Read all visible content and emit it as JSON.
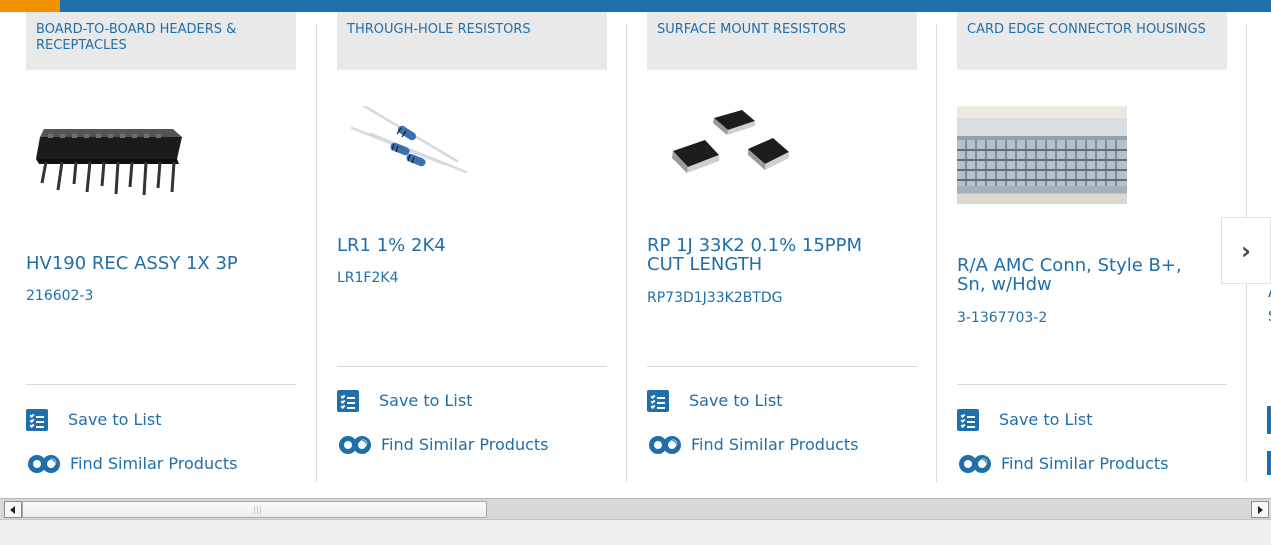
{
  "theme": {
    "brand_blue": "#1f6fab",
    "accent_orange": "#f29100",
    "category_bg": "#e9e9e9",
    "divider": "#d9d9d9"
  },
  "carousel": {
    "next_icon": "chevron-right-icon",
    "cards": [
      {
        "category": "BOARD-TO-BOARD HEADERS & RECEPTACLES",
        "title": "HV190 REC ASSY 1X 3P",
        "sku": "216602-3",
        "image": "header-connector-image",
        "save_label": "Save to List",
        "similar_label": "Find Similar Products"
      },
      {
        "category": "THROUGH-HOLE RESISTORS",
        "title": "LR1 1% 2K4",
        "sku": "LR1F2K4",
        "image": "through-hole-resistors-image",
        "save_label": "Save to List",
        "similar_label": "Find Similar Products"
      },
      {
        "category": "SURFACE MOUNT RESISTORS",
        "title": "RP 1J 33K2 0.1% 15PPM CUT LENGTH",
        "sku": "RP73D1J33K2BTDG",
        "image": "surface-mount-resistors-image",
        "save_label": "Save to List",
        "similar_label": "Find Similar Products"
      },
      {
        "category": "CARD EDGE CONNECTOR HOUSINGS",
        "title": "R/A AMC Conn, Style B+, Sn, w/Hdw",
        "sku": "3-1367703-2",
        "image": "card-edge-connector-image",
        "save_label": "Save to List",
        "similar_label": "Find Similar Products"
      }
    ],
    "partial_next_card": {
      "title_peek": "A",
      "sku_peek": "S"
    }
  },
  "scrollbar": {
    "left_icon": "scroll-left-arrow-icon",
    "right_icon": "scroll-right-arrow-icon",
    "thumb_icon": "scroll-thumb"
  }
}
